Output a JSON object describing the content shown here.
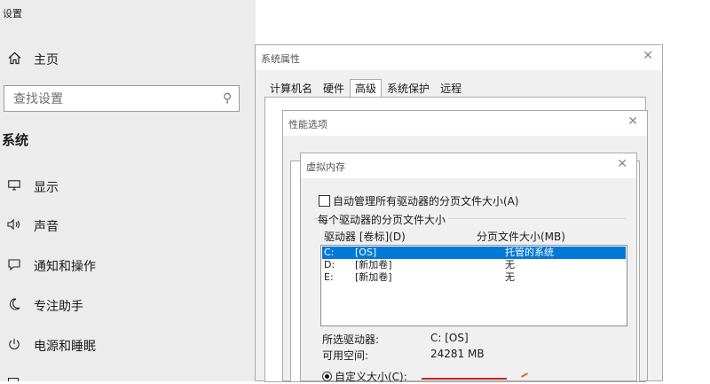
{
  "settings": {
    "app_title": "设置",
    "home_label": "主页",
    "search_placeholder": "查找设置",
    "section_title": "系统",
    "nav": [
      {
        "label": "显示",
        "icon": "monitor-icon"
      },
      {
        "label": "声音",
        "icon": "speaker-icon"
      },
      {
        "label": "通知和操作",
        "icon": "notification-icon"
      },
      {
        "label": "专注助手",
        "icon": "moon-icon"
      },
      {
        "label": "电源和睡眠",
        "icon": "power-icon"
      }
    ]
  },
  "system_properties": {
    "title": "系统属性",
    "tabs": [
      "计算机名",
      "硬件",
      "高级",
      "系统保护",
      "远程"
    ],
    "active_tab": "高级"
  },
  "performance_options": {
    "title": "性能选项"
  },
  "virtual_memory": {
    "title": "虚拟内存",
    "auto_manage_label": "自动管理所有驱动器的分页文件大小(A)",
    "auto_manage_checked": false,
    "group_title": "每个驱动器的分页文件大小",
    "col_drive": "驱动器 [卷标](D)",
    "col_size": "分页文件大小(MB)",
    "drives": [
      {
        "drive": "C:",
        "label": "[OS]",
        "size": "托管的系统",
        "selected": true
      },
      {
        "drive": "D:",
        "label": "[新加卷]",
        "size": "无",
        "selected": false
      },
      {
        "drive": "E:",
        "label": "[新加卷]",
        "size": "无",
        "selected": false
      }
    ],
    "selected_drive_label": "所选驱动器:",
    "selected_drive_value": "C:  [OS]",
    "free_space_label": "可用空间:",
    "free_space_value": "24281 MB",
    "custom_size_label": "自定义大小(C):"
  }
}
